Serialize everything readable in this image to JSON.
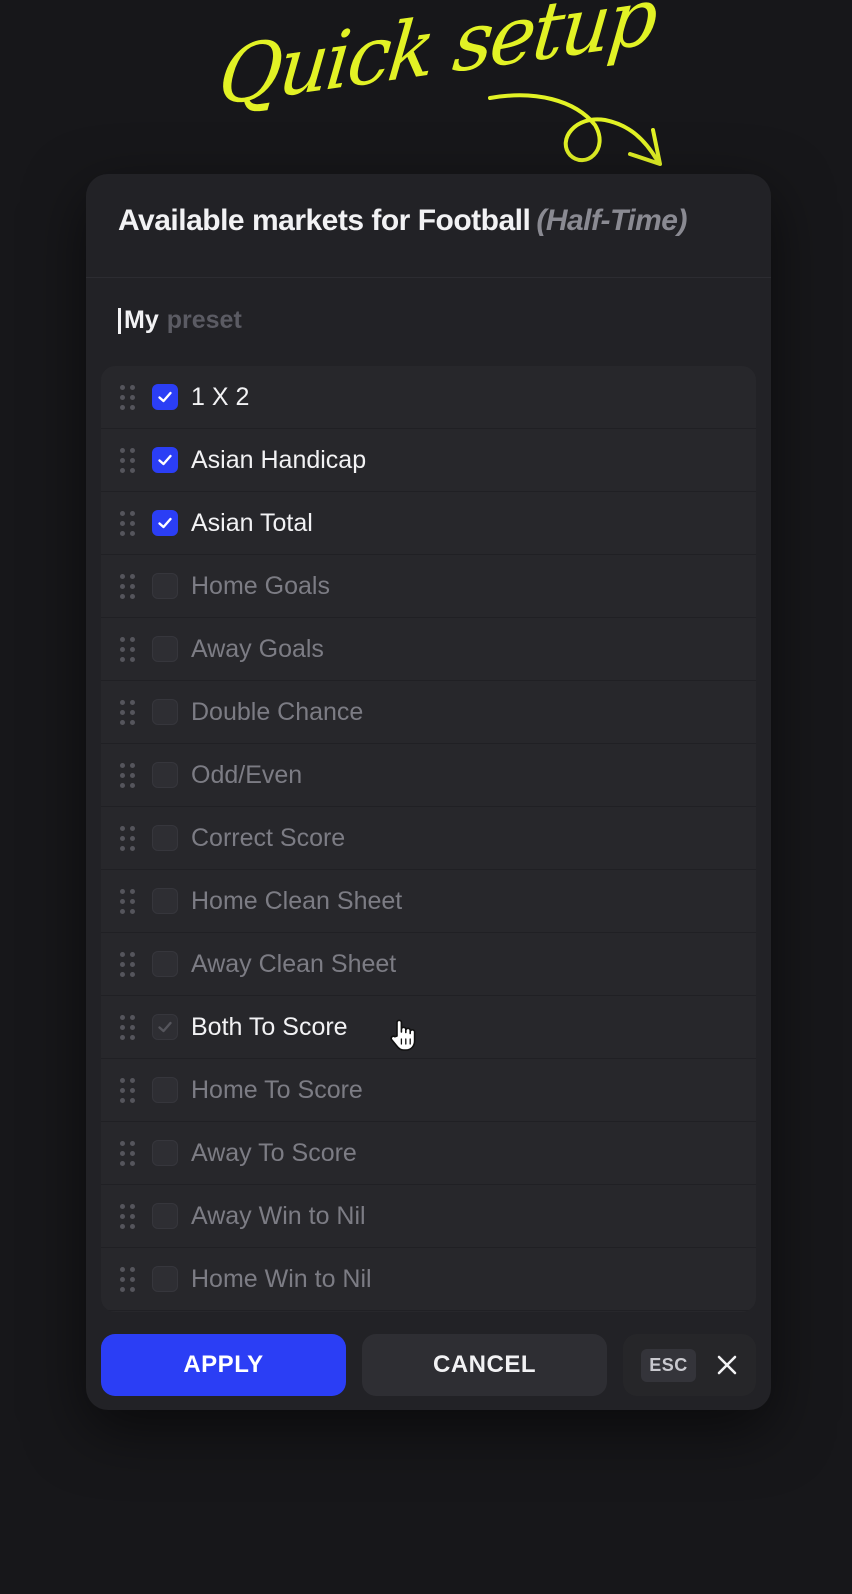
{
  "annotation": {
    "text": "Quick setup"
  },
  "modal": {
    "title": "Available markets for Football",
    "subtitle": "(Half-Time)"
  },
  "preset": {
    "value": "My",
    "placeholder": "preset"
  },
  "markets": [
    {
      "label": "1 X 2",
      "checked": true
    },
    {
      "label": "Asian Handicap",
      "checked": true
    },
    {
      "label": "Asian Total",
      "checked": true
    },
    {
      "label": "Home Goals",
      "checked": false
    },
    {
      "label": "Away Goals",
      "checked": false
    },
    {
      "label": "Double Chance",
      "checked": false
    },
    {
      "label": "Odd/Even",
      "checked": false
    },
    {
      "label": "Correct Score",
      "checked": false
    },
    {
      "label": "Home Clean Sheet",
      "checked": false
    },
    {
      "label": "Away Clean Sheet",
      "checked": false
    },
    {
      "label": "Both To Score",
      "checked": false,
      "hovered": true
    },
    {
      "label": "Home To Score",
      "checked": false
    },
    {
      "label": "Away To Score",
      "checked": false
    },
    {
      "label": "Away Win to Nil",
      "checked": false
    },
    {
      "label": "Home Win to Nil",
      "checked": false
    }
  ],
  "footer": {
    "apply_label": "APPLY",
    "cancel_label": "CANCEL",
    "esc_label": "ESC"
  },
  "colors": {
    "accent": "#2b3ef5",
    "annotation": "#e2f225",
    "background": "#17171a",
    "panel": "#222226"
  },
  "icons": [
    "drag-handle-icon",
    "checkmark-icon",
    "close-icon",
    "hand-pointer-icon",
    "curved-arrow-icon"
  ]
}
